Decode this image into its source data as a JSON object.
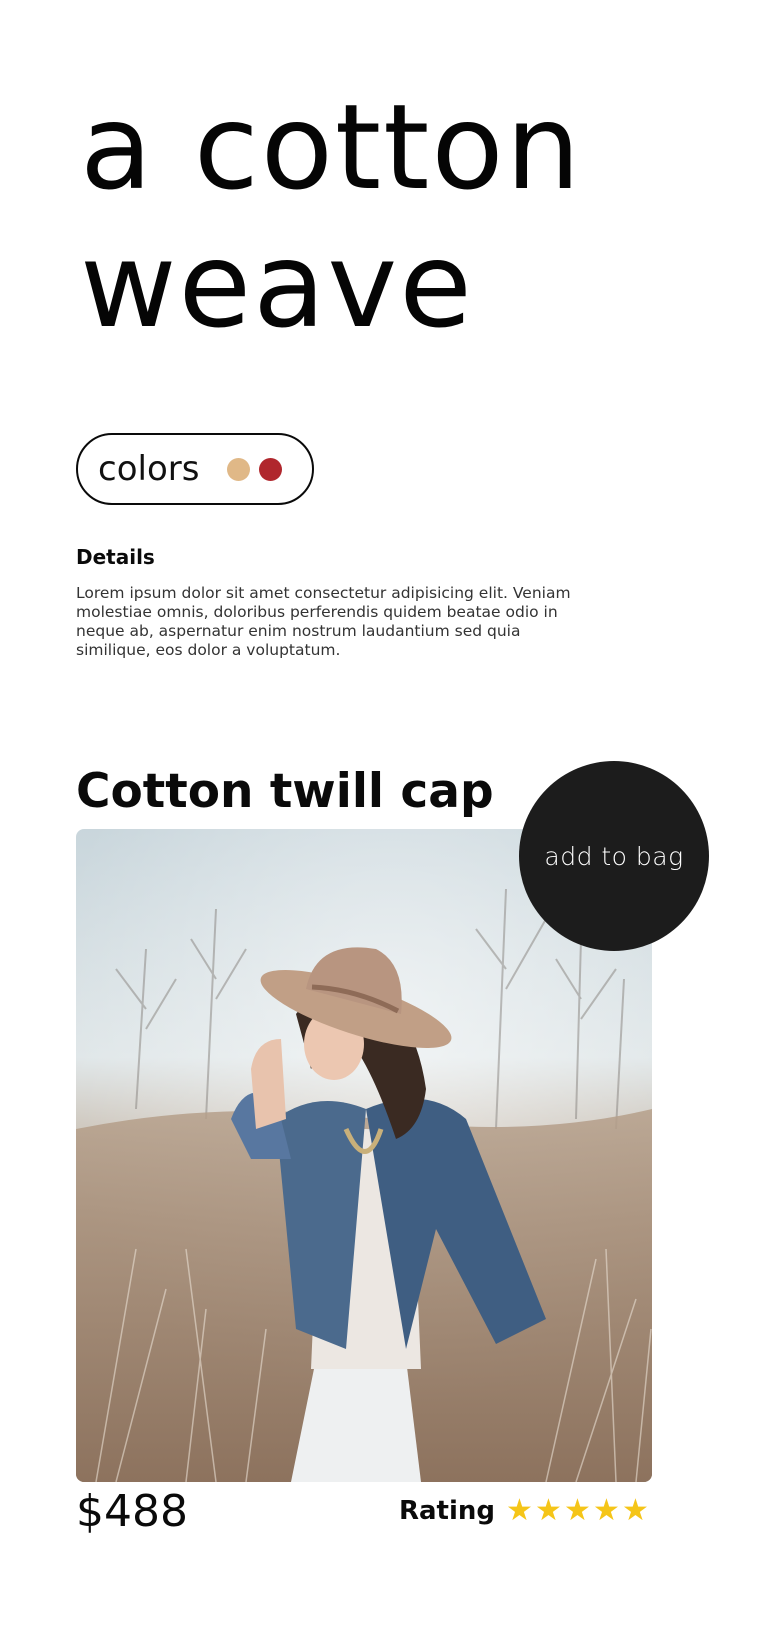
{
  "hero": {
    "title": "a cotton weave"
  },
  "colors": {
    "label": "colors",
    "swatches": [
      {
        "name": "tan",
        "hex": "#e0b887"
      },
      {
        "name": "red",
        "hex": "#b0272d"
      }
    ]
  },
  "details": {
    "heading": "Details",
    "body": "Lorem ipsum dolor sit amet consectetur adipisicing elit. Veniam molestiae omnis, doloribus perferendis quidem beatae odio in neque ab, aspernatur enim nostrum laudantium sed quia similique, eos dolor a voluptatum."
  },
  "product": {
    "title": "Cotton twill cap",
    "add_to_bag_label": "add to bag",
    "price": "$488",
    "rating_label": "Rating",
    "rating": 5,
    "rating_max": 5,
    "star_color": "#f5c518"
  }
}
